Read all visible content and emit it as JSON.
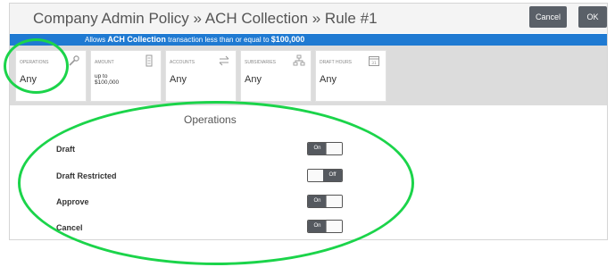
{
  "header": {
    "title": "Company Admin Policy » ACH Collection » Rule #1",
    "cancel_label": "Cancel",
    "ok_label": "OK"
  },
  "banner": {
    "prefix": "Allows",
    "bold_entity": "ACH Collection",
    "middle": "transaction less than or equal to",
    "bold_amount": "$100,000"
  },
  "cards": [
    {
      "label": "Operations",
      "value": "Any",
      "icon": "wrench-icon"
    },
    {
      "label": "Amount",
      "value": "up to $100,000",
      "icon": "building-icon"
    },
    {
      "label": "Accounts",
      "value": "Any",
      "icon": "transfer-arrows-icon"
    },
    {
      "label": "Subsidiaries",
      "value": "Any",
      "icon": "network-icon"
    },
    {
      "label": "Draft Hours",
      "value": "Any",
      "icon": "calendar-icon"
    }
  ],
  "operations": {
    "title": "Operations",
    "rows": [
      {
        "label": "Draft",
        "state": "On"
      },
      {
        "label": "Draft Restricted",
        "state": "Off"
      },
      {
        "label": "Approve",
        "state": "On"
      },
      {
        "label": "Cancel",
        "state": "On"
      }
    ]
  },
  "annotation_color": "#1bd44a"
}
